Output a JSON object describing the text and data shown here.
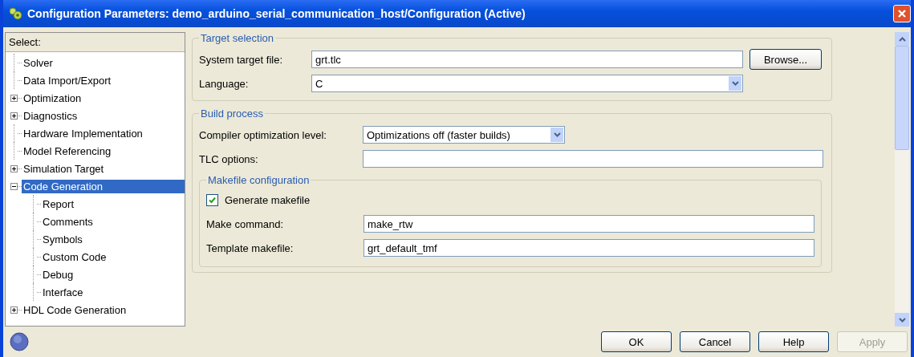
{
  "window": {
    "title": "Configuration Parameters: demo_arduino_serial_communication_host/Configuration (Active)"
  },
  "tree": {
    "header": "Select:",
    "items": [
      {
        "label": "Solver",
        "selected": false
      },
      {
        "label": "Data Import/Export",
        "selected": false
      },
      {
        "label": "Optimization",
        "selected": false,
        "expanded": false
      },
      {
        "label": "Diagnostics",
        "selected": false,
        "expanded": false
      },
      {
        "label": "Hardware Implementation",
        "selected": false
      },
      {
        "label": "Model Referencing",
        "selected": false
      },
      {
        "label": "Simulation Target",
        "selected": false,
        "expanded": false
      },
      {
        "label": "Code Generation",
        "selected": true,
        "expanded": true,
        "children": [
          {
            "label": "Report",
            "selected": false
          },
          {
            "label": "Comments",
            "selected": false
          },
          {
            "label": "Symbols",
            "selected": false
          },
          {
            "label": "Custom Code",
            "selected": false
          },
          {
            "label": "Debug",
            "selected": false
          },
          {
            "label": "Interface",
            "selected": false
          }
        ]
      },
      {
        "label": "HDL Code Generation",
        "selected": false,
        "expanded": false
      }
    ]
  },
  "sections": [
    {
      "title": "Target selection",
      "rows": [
        {
          "kind": "text",
          "label": "System target file:",
          "value": "grt.tlc",
          "button": "Browse..."
        },
        {
          "kind": "dropdown",
          "label": "Language:",
          "value": "C"
        }
      ]
    },
    {
      "title": "Build process",
      "rows": [
        {
          "kind": "dropdown",
          "label": "Compiler optimization level:",
          "value": "Optimizations off (faster builds)"
        },
        {
          "kind": "text",
          "label": "TLC options:"
        }
      ],
      "subsections": [
        {
          "title": "Makefile configuration",
          "rows": [
            {
              "kind": "checkbox",
              "label": "Generate makefile",
              "checked": true
            },
            {
              "kind": "text",
              "label": "Make command:",
              "value": "make_rtw"
            },
            {
              "kind": "text",
              "label": "Template makefile:",
              "value": "grt_default_tmf"
            }
          ]
        }
      ]
    }
  ],
  "buttons": [
    {
      "label": "OK",
      "disabled": false
    },
    {
      "label": "Cancel",
      "disabled": false
    },
    {
      "label": "Help",
      "disabled": false
    },
    {
      "label": "Apply",
      "disabled": true
    }
  ]
}
